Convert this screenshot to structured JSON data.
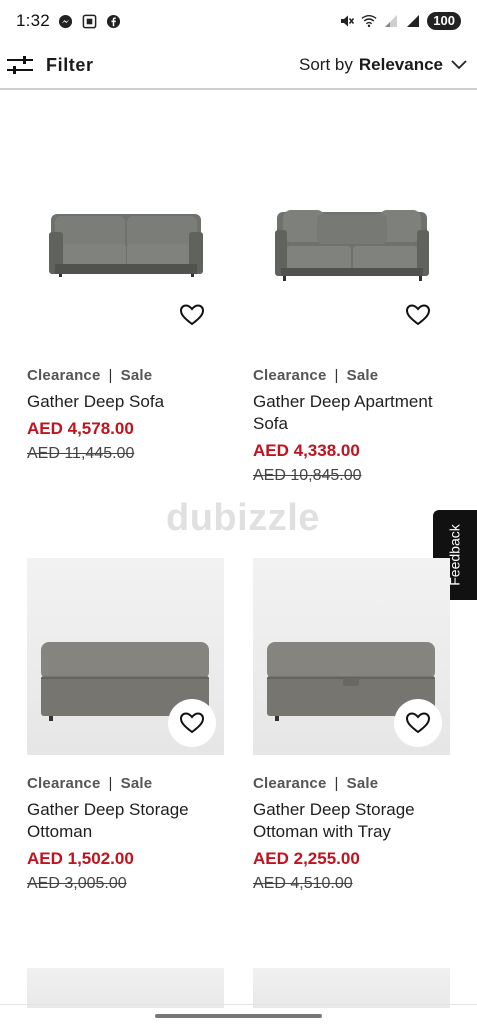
{
  "status_bar": {
    "time": "1:32",
    "battery": "100",
    "left_icons": [
      "messenger-icon",
      "screenshot-icon",
      "facebook-icon"
    ],
    "right_icons": [
      "mute-icon",
      "wifi-icon",
      "signal-icon",
      "signal-icon"
    ]
  },
  "toolbar": {
    "filter_label": "Filter",
    "sort_prefix": "Sort by",
    "sort_value": "Relevance"
  },
  "products": [
    {
      "badge_1": "Clearance",
      "separator": "|",
      "badge_2": "Sale",
      "name_line_1": "Gather Deep Sofa",
      "name_line_2": "",
      "price": "AED 4,578.00",
      "old_price": "AED 11,445.00"
    },
    {
      "badge_1": "Clearance",
      "separator": "|",
      "badge_2": "Sale",
      "name_line_1": "Gather Deep Apartment",
      "name_line_2": "Sofa",
      "price": "AED 4,338.00",
      "old_price": "AED 10,845.00"
    },
    {
      "badge_1": "Clearance",
      "separator": "|",
      "badge_2": "Sale",
      "name_line_1": "Gather Deep Storage",
      "name_line_2": "Ottoman",
      "price": "AED 1,502.00",
      "old_price": "AED 3,005.00"
    },
    {
      "badge_1": "Clearance",
      "separator": "|",
      "badge_2": "Sale",
      "name_line_1": "Gather Deep Storage",
      "name_line_2": "Ottoman with Tray",
      "price": "AED 2,255.00",
      "old_price": "AED 4,510.00"
    }
  ],
  "watermark": "dubizzle",
  "feedback_label": "Feedback",
  "colors": {
    "sale_price": "#c1121f",
    "text": "#1b1b1b",
    "badge": "#555555",
    "feedback_bg": "#111111"
  }
}
